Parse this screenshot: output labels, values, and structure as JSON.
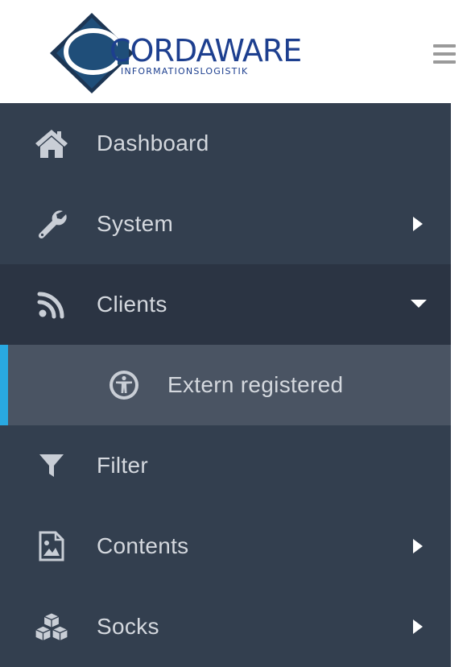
{
  "header": {
    "logo_name": "CORDAWARE",
    "logo_tagline": "INFORMATIONSLOGISTIK",
    "menu_icon": "hamburger-icon"
  },
  "sidebar": {
    "items": [
      {
        "label": "Dashboard",
        "icon": "home-icon",
        "has_submenu": false
      },
      {
        "label": "System",
        "icon": "wrench-icon",
        "has_submenu": true,
        "expanded": false
      },
      {
        "label": "Clients",
        "icon": "rss-icon",
        "has_submenu": true,
        "expanded": true,
        "children": [
          {
            "label": "Extern registered",
            "icon": "accessibility-icon",
            "active": true
          }
        ]
      },
      {
        "label": "Filter",
        "icon": "filter-icon",
        "has_submenu": false
      },
      {
        "label": "Contents",
        "icon": "image-file-icon",
        "has_submenu": true,
        "expanded": false
      },
      {
        "label": "Socks",
        "icon": "cubes-icon",
        "has_submenu": true,
        "expanded": false
      }
    ]
  },
  "colors": {
    "sidebar_bg": "#333f4f",
    "open_item_bg": "#2b3443",
    "active_sub_bg": "#4a5463",
    "active_accent": "#29a9e1",
    "text": "#d4d8de",
    "logo_blue": "#1d3f8f"
  }
}
